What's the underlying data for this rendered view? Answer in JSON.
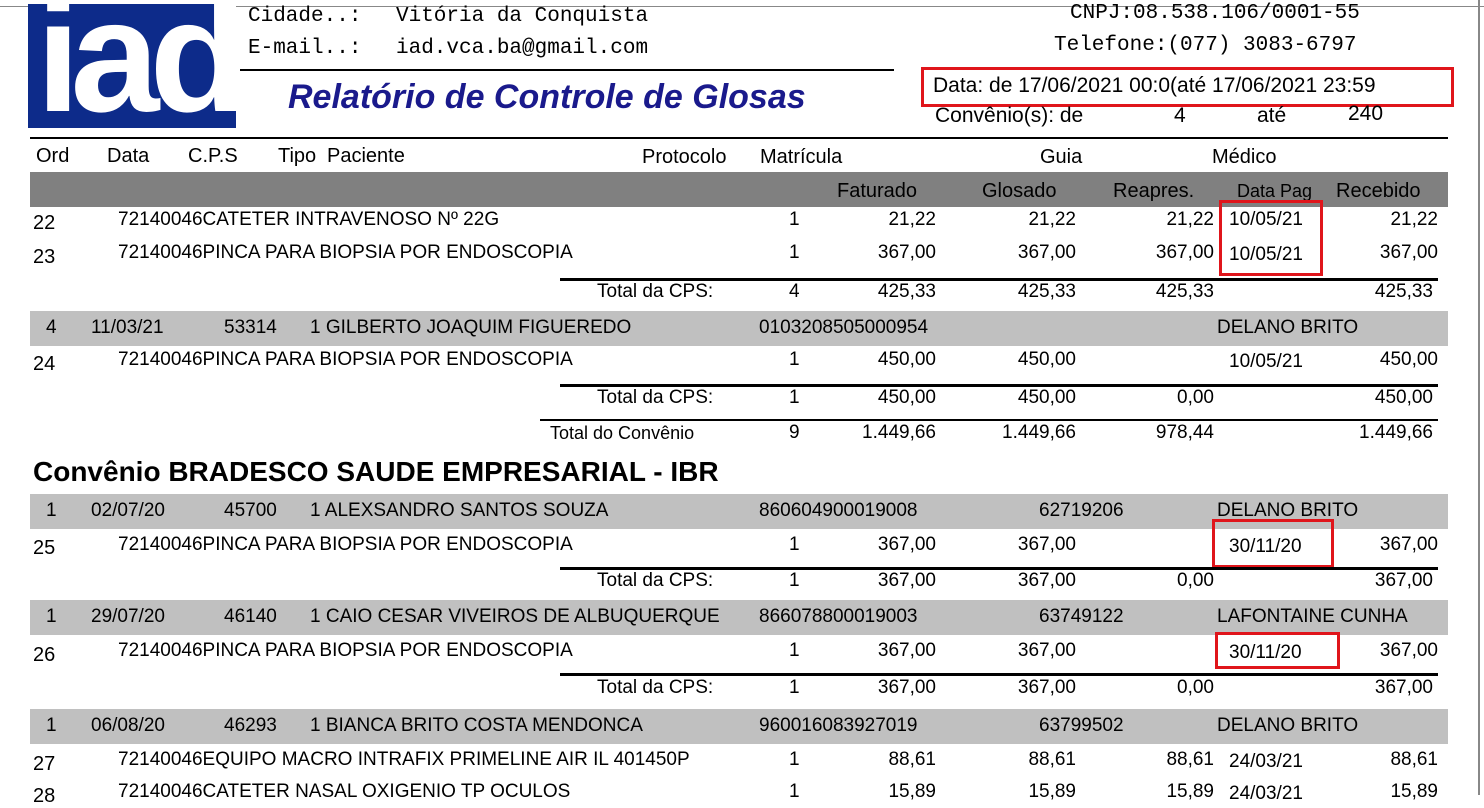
{
  "header": {
    "cidade_label": "Cidade..:",
    "cidade_value": "Vitória da Conquista",
    "email_label": "E-mail..:",
    "email_value": "iad.vca.ba@gmail.com",
    "cnpj": "CNPJ:08.538.106/0001-55",
    "telefone": "Telefone:(077) 3083-6797",
    "title": "Relatório de Controle de Glosas",
    "date_range": "Data: de 17/06/2021 00:0(até 17/06/2021 23:59",
    "convenio_label": "Convênio(s): de",
    "convenio_from": "4",
    "convenio_ate": "até",
    "convenio_to": "240"
  },
  "columns": {
    "row1": {
      "ord": "Ord",
      "data": "Data",
      "cps": "C.P.S",
      "tipo": "Tipo",
      "paciente": "Paciente",
      "protocolo": "Protocolo",
      "matricula": "Matrícula",
      "guia": "Guia",
      "medico": "Médico"
    },
    "row2": {
      "faturado": "Faturado",
      "glosado": "Glosado",
      "reapres": "Reapres.",
      "data_pag": "Data Pag",
      "recebido": "Recebido"
    }
  },
  "rows": {
    "r22": {
      "ord": "22",
      "desc": "72140046CATETER INTRAVENOSO Nº 22G",
      "qty": "1",
      "faturado": "21,22",
      "glosado": "21,22",
      "reapres": "21,22",
      "data_pag": "10/05/21",
      "recebido": "21,22"
    },
    "r23": {
      "ord": "23",
      "desc": "72140046PINCA PARA BIOPSIA POR ENDOSCOPIA",
      "qty": "1",
      "faturado": "367,00",
      "glosado": "367,00",
      "reapres": "367,00",
      "data_pag": "10/05/21",
      "recebido": "367,00"
    },
    "t1": {
      "label": "Total da CPS:",
      "qty": "4",
      "faturado": "425,33",
      "glosado": "425,33",
      "reapres": "425,33",
      "recebido": "425,33"
    },
    "g1": {
      "ord": "4",
      "data": "11/03/21",
      "cps": "53314",
      "paciente": "1 GILBERTO JOAQUIM FIGUEREDO",
      "protocolo": "0103208505000954",
      "guia": "",
      "medico": "DELANO BRITO"
    },
    "r24": {
      "ord": "24",
      "desc": "72140046PINCA PARA BIOPSIA POR ENDOSCOPIA",
      "qty": "1",
      "faturado": "450,00",
      "glosado": "450,00",
      "data_pag": "10/05/21",
      "recebido": "450,00"
    },
    "t2": {
      "label": "Total da CPS:",
      "qty": "1",
      "faturado": "450,00",
      "glosado": "450,00",
      "reapres": "0,00",
      "recebido": "450,00"
    },
    "tc": {
      "label": "Total do Convênio",
      "qty": "9",
      "faturado": "1.449,66",
      "glosado": "1.449,66",
      "reapres": "978,44",
      "recebido": "1.449,66"
    }
  },
  "convenio_title": "Convênio BRADESCO SAUDE EMPRESARIAL - IBR",
  "rows2": {
    "g2": {
      "ord": "1",
      "data": "02/07/20",
      "cps": "45700",
      "paciente": "1 ALEXSANDRO SANTOS SOUZA",
      "protocolo": "860604900019008",
      "guia": "62719206",
      "medico": "DELANO BRITO"
    },
    "r25": {
      "ord": "25",
      "desc": "72140046PINCA PARA BIOPSIA POR ENDOSCOPIA",
      "qty": "1",
      "faturado": "367,00",
      "glosado": "367,00",
      "data_pag": "30/11/20",
      "recebido": "367,00"
    },
    "t3": {
      "label": "Total da CPS:",
      "qty": "1",
      "faturado": "367,00",
      "glosado": "367,00",
      "reapres": "0,00",
      "recebido": "367,00"
    },
    "g3": {
      "ord": "1",
      "data": "29/07/20",
      "cps": "46140",
      "paciente": "1 CAIO CESAR VIVEIROS DE ALBUQUERQUE",
      "protocolo": "866078800019003",
      "guia": "63749122",
      "medico": "LAFONTAINE CUNHA"
    },
    "r26": {
      "ord": "26",
      "desc": "72140046PINCA PARA BIOPSIA POR ENDOSCOPIA",
      "qty": "1",
      "faturado": "367,00",
      "glosado": "367,00",
      "data_pag": "30/11/20",
      "recebido": "367,00"
    },
    "t4": {
      "label": "Total da CPS:",
      "qty": "1",
      "faturado": "367,00",
      "glosado": "367,00",
      "reapres": "0,00",
      "recebido": "367,00"
    },
    "g4": {
      "ord": "1",
      "data": "06/08/20",
      "cps": "46293",
      "paciente": "1 BIANCA BRITO COSTA MENDONCA",
      "protocolo": "960016083927019",
      "guia": "63799502",
      "medico": "DELANO BRITO"
    },
    "r27": {
      "ord": "27",
      "desc": "72140046EQUIPO MACRO INTRAFIX PRIMELINE AIR IL 401450P",
      "qty": "1",
      "faturado": "88,61",
      "glosado": "88,61",
      "reapres": "88,61",
      "data_pag": "24/03/21",
      "recebido": "88,61"
    },
    "r28": {
      "ord": "28",
      "desc": "72140046CATETER NASAL OXIGENIO TP OCULOS",
      "qty": "1",
      "faturado": "15,89",
      "glosado": "15,89",
      "reapres": "15,89",
      "data_pag": "24/03/21",
      "recebido": "15,89"
    }
  },
  "colors": {
    "band": "#c0c0c0",
    "title_blue": "#1a1a8c",
    "logo_blue": "#0d2b8a",
    "highlight_red": "#e0151b"
  },
  "logo": {
    "text": "iad"
  }
}
